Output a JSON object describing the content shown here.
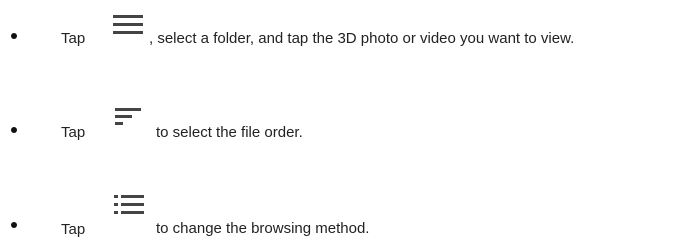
{
  "instructions": [
    {
      "prefix": "Tap",
      "icon": "menu-icon",
      "text": ", select a folder, and tap the 3D photo or video you want to view."
    },
    {
      "prefix": "Tap",
      "icon": "sort-order-icon",
      "text": "to select the file order."
    },
    {
      "prefix": "Tap",
      "icon": "list-view-icon",
      "text": "to change the browsing method."
    }
  ],
  "colors": {
    "text": "#222222",
    "icon": "#444444",
    "bullet": "#111111"
  }
}
